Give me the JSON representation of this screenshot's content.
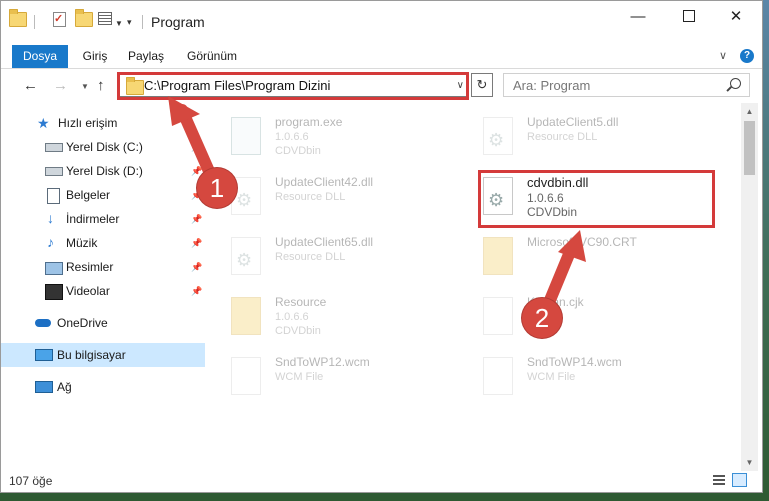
{
  "window": {
    "title": "Program"
  },
  "ribbon": {
    "tabs": [
      {
        "label": "Dosya",
        "active": true
      },
      {
        "label": "Giriş"
      },
      {
        "label": "Paylaş"
      },
      {
        "label": "Görünüm"
      }
    ],
    "help": "?"
  },
  "nav": {
    "address": "C:\\Program Files\\Program Dizini",
    "search_placeholder": "Ara: Program"
  },
  "sidebar": {
    "items": [
      {
        "label": "Hızlı erişim",
        "icon": "star-icon"
      },
      {
        "label": "Yerel Disk (C:)",
        "icon": "drive-icon",
        "pinned": true
      },
      {
        "label": "Yerel Disk (D:)",
        "icon": "drive-icon",
        "pinned": true
      },
      {
        "label": "Belgeler",
        "icon": "documents-icon",
        "pinned": true
      },
      {
        "label": "İndirmeler",
        "icon": "downloads-icon",
        "pinned": true
      },
      {
        "label": "Müzik",
        "icon": "music-icon",
        "pinned": true
      },
      {
        "label": "Resimler",
        "icon": "pictures-icon",
        "pinned": true
      },
      {
        "label": "Videolar",
        "icon": "videos-icon",
        "pinned": true
      },
      {
        "label": "OneDrive",
        "icon": "onedrive-icon"
      },
      {
        "label": "Bu bilgisayar",
        "icon": "computer-icon",
        "selected": true
      },
      {
        "label": "Ağ",
        "icon": "network-icon"
      }
    ]
  },
  "files": [
    {
      "name": "program.exe",
      "line1": "1.0.6.6",
      "line2": "CDVDbin"
    },
    {
      "name": "UpdateClient5.dll",
      "line1": "Resource DLL",
      "line2": ""
    },
    {
      "name": "UpdateClient42.dll",
      "line1": "Resource DLL",
      "line2": ""
    },
    {
      "name": "cdvdbin.dll",
      "line1": "1.0.6.6",
      "line2": "CDVDbin"
    },
    {
      "name": "UpdateClient65.dll",
      "line1": "Resource DLL",
      "line2": ""
    },
    {
      "name": "Microsoft.VC90.CRT",
      "line1": "",
      "line2": ""
    },
    {
      "name": "Resource",
      "line1": "1.0.6.6",
      "line2": "CDVDbin"
    },
    {
      "name": "Kitsilan.cjk",
      "line1": "",
      "line2": ""
    },
    {
      "name": "SndToWP12.wcm",
      "line1": "WCM File",
      "line2": ""
    },
    {
      "name": "SndToWP14.wcm",
      "line1": "WCM File",
      "line2": ""
    }
  ],
  "status": {
    "item_count": "107 öğe"
  },
  "annotations": {
    "step1": "1",
    "step2": "2",
    "color": "#d5483f"
  }
}
